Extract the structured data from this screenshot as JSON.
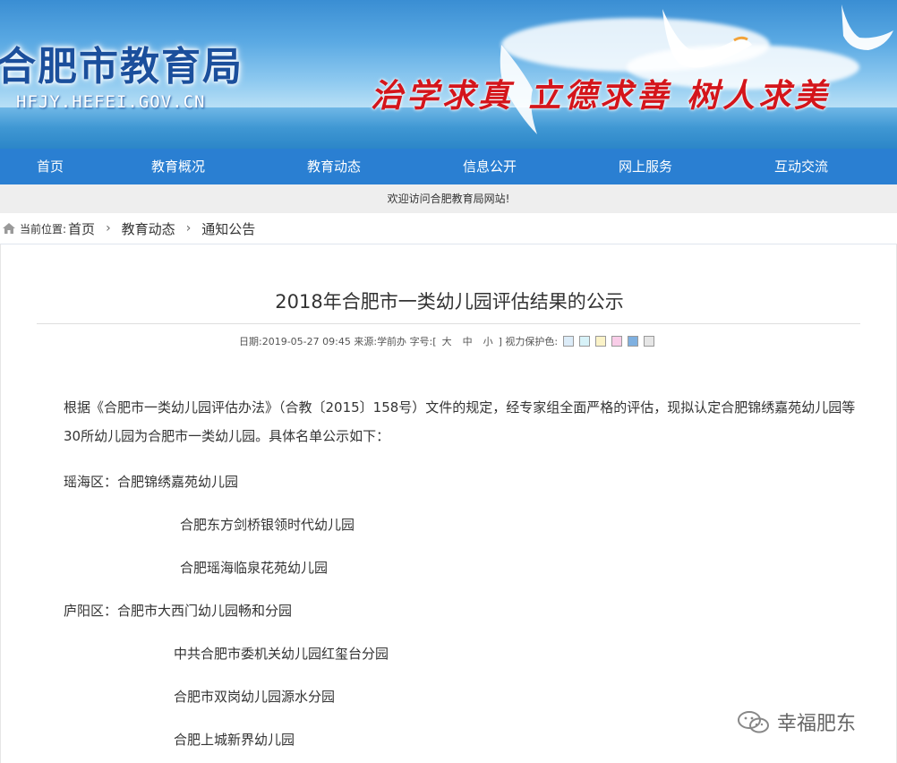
{
  "header": {
    "site_title": "合肥市教育局",
    "site_domain": "HFJY.HEFEI.GOV.CN",
    "slogan": "治学求真 立德求善 树人求美"
  },
  "nav": {
    "items": [
      "首页",
      "教育概况",
      "教育动态",
      "信息公开",
      "网上服务",
      "互动交流"
    ]
  },
  "welcome": "欢迎访问合肥教育局网站!",
  "breadcrumb": {
    "current_label": "当前位置:",
    "items": [
      "首页",
      "教育动态",
      "通知公告"
    ]
  },
  "article": {
    "title": "2018年合肥市一类幼儿园评估结果的公示",
    "meta": {
      "date_label": "日期:",
      "date": "2019-05-27 09:45",
      "source_label": "来源:",
      "source": "学前办",
      "font_label": "字号:[",
      "font_sizes": [
        "大",
        "中",
        "小"
      ],
      "font_end": "]",
      "eye_label": "视力保护色:"
    },
    "intro": "根据《合肥市一类幼儿园评估办法》（合教〔2015〕158号）文件的规定，经专家组全面严格的评估，现拟认定合肥锦绣嘉苑幼儿园等30所幼儿园为合肥市一类幼儿园。具体名单公示如下：",
    "lines": [
      "瑶海区：合肥锦绣嘉苑幼儿园",
      "合肥东方剑桥银领时代幼儿园",
      "合肥瑶海临泉花苑幼儿园",
      "庐阳区：合肥市大西门幼儿园畅和分园",
      "中共合肥市委机关幼儿园红玺台分园",
      "合肥市双岗幼儿园源水分园",
      "合肥上城新界幼儿园"
    ]
  },
  "eye_colors": [
    "#dcecf8",
    "#d7f2f8",
    "#fbf3c8",
    "#f9cde8",
    "#7fb0e0",
    "#e6e6e6"
  ],
  "watermark": "幸福肥东",
  "colors": {
    "nav_bg": "#2a7fd2",
    "slogan": "#d4151b",
    "title_blue": "#1b4f9c"
  }
}
